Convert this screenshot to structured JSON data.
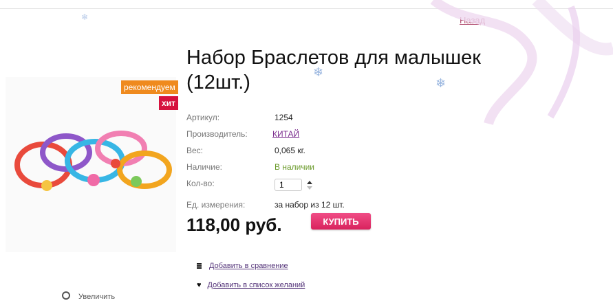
{
  "header": {
    "back_label": "Назад"
  },
  "badges": {
    "recommend": "рекомендуем",
    "hit": "хит"
  },
  "product": {
    "title": "Набор Браслетов для малышек (12шт.)",
    "details": [
      {
        "label": "Артикул:",
        "value": "1254"
      },
      {
        "label": "Производитель:",
        "value": "КИТАЙ"
      },
      {
        "label": "Вес:",
        "value": "0,065 кг."
      },
      {
        "label": "Наличие:",
        "value": "В наличии"
      },
      {
        "label": "Кол-во:",
        "value": "1"
      },
      {
        "label": "Ед. измерения:",
        "value": "за набор из 12 шт."
      }
    ],
    "price": "118,00 руб.",
    "buy_label": "КУПИТЬ"
  },
  "actions": {
    "compare": "Добавить в сравнение",
    "wishlist": "Добавить в список желаний"
  },
  "image": {
    "zoom_label": "Увеличить"
  },
  "colors": {
    "accent_pink": "#e0336e",
    "badge_orange": "#ef8a1e",
    "badge_red": "#d6123e",
    "in_stock_green": "#6a9a2a",
    "link_purple": "#7b2d8e"
  }
}
